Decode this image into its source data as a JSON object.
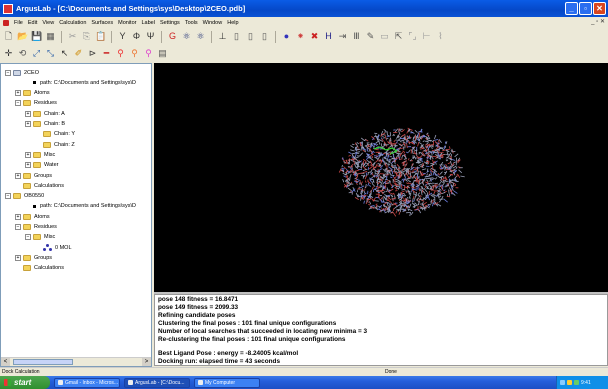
{
  "window": {
    "title": "ArgusLab - [C:\\Documents and Settings\\sys\\Desktop\\2CEO.pdb]",
    "minimize": "_",
    "restore": "▫",
    "close": "✕"
  },
  "menu": {
    "items": [
      "File",
      "Edit",
      "View",
      "Calculation",
      "Surfaces",
      "Monitor",
      "Label",
      "Settings",
      "Tools",
      "Window",
      "Help"
    ],
    "window_controls": "_ ▫ ✕"
  },
  "toolbar1": {
    "icons": [
      "new-file-icon",
      "open-folder-icon",
      "save-icon",
      "print-icon",
      "cut-icon",
      "copy-icon",
      "paste-icon",
      "y-icon",
      "phi-icon",
      "psi-icon",
      "g-icon",
      "ligand-icon",
      "build-icon",
      "perpendicular-icon",
      "box-icon",
      "box2-icon",
      "box3-icon",
      "dot-icon",
      "hydrogen-icon",
      "x-icon",
      "h-icon",
      "hetero-icon",
      "bond-icon",
      "arrow-icon",
      "square-icon",
      "select-icon",
      "bracket-icon",
      "path-icon",
      "link-icon"
    ],
    "glyphs": [
      "🗋",
      "📂",
      "💾",
      "▦",
      "✂",
      "⎘",
      "📋",
      "Y",
      "Φ",
      "Ψ",
      "G",
      "⚛",
      "⚛",
      "⊥",
      "▯",
      "▯",
      "▯",
      "●",
      "⁕",
      "✖",
      "H",
      "⇥",
      "Ⅲ",
      "✎",
      "▭",
      "⇱",
      "⌜⌟",
      "⊢",
      "⌇"
    ]
  },
  "toolbar2": {
    "icons": [
      "rotate-icon",
      "translate-icon",
      "zoom-icon",
      "zoom2-icon",
      "arrow-select-icon",
      "pencil-icon",
      "residue-icon",
      "minus-icon",
      "atom-red-icon",
      "atom-orange-icon",
      "atom-pink-icon",
      "grid-icon"
    ],
    "glyphs": [
      "✛",
      "⟲",
      "⤢",
      "⤡",
      "↖",
      "✐",
      "⊳",
      "━",
      "⚲",
      "⚲",
      "⚲",
      "▤"
    ]
  },
  "tree": {
    "nodes": [
      {
        "label": "2CEO",
        "pm": "−",
        "kind": "root",
        "indent": 0
      },
      {
        "label": "path: C:\\Documents and Settings\\sys\\D",
        "pm": "",
        "kind": "dot",
        "indent": 2
      },
      {
        "label": "Atoms",
        "pm": "+",
        "kind": "folder",
        "indent": 1
      },
      {
        "label": "Residues",
        "pm": "−",
        "kind": "folder",
        "indent": 1
      },
      {
        "label": "Chain: A",
        "pm": "+",
        "kind": "folder",
        "indent": 2
      },
      {
        "label": "Chain: B",
        "pm": "+",
        "kind": "folder",
        "indent": 2
      },
      {
        "label": "Chain: Y",
        "pm": "",
        "kind": "folder",
        "indent": 3
      },
      {
        "label": "Chain: Z",
        "pm": "",
        "kind": "folder",
        "indent": 3
      },
      {
        "label": "Misc",
        "pm": "+",
        "kind": "folder",
        "indent": 2
      },
      {
        "label": "Water",
        "pm": "+",
        "kind": "folder",
        "indent": 2
      },
      {
        "label": "Groups",
        "pm": "+",
        "kind": "folder",
        "indent": 1
      },
      {
        "label": "Calculations",
        "pm": "",
        "kind": "folder",
        "indent": 1
      },
      {
        "label": "OB0550",
        "pm": "−",
        "kind": "folder",
        "indent": 0
      },
      {
        "label": "path: C:\\Documents and Settings\\sys\\D",
        "pm": "",
        "kind": "dot",
        "indent": 2
      },
      {
        "label": "Atoms",
        "pm": "+",
        "kind": "folder",
        "indent": 1
      },
      {
        "label": "Residues",
        "pm": "−",
        "kind": "folder",
        "indent": 1
      },
      {
        "label": "Misc",
        "pm": "−",
        "kind": "folder",
        "indent": 2
      },
      {
        "label": "0 MOL",
        "pm": "",
        "kind": "mol",
        "indent": 3
      },
      {
        "label": "Groups",
        "pm": "+",
        "kind": "folder",
        "indent": 1
      },
      {
        "label": "Calculations",
        "pm": "",
        "kind": "folder",
        "indent": 1
      }
    ],
    "scroll_left": "<",
    "scroll_right": ">"
  },
  "output": {
    "lines": [
      "pose 148 fitness = 16.8471",
      "pose 149 fitness = 2099.33",
      "Refining candidate poses",
      "Clustering the final poses : 101 final unique configurations",
      "Number of local searches that succeeded in locating new minima = 3",
      "Re-clustering the final poses : 101 final unique configurations",
      "",
      "Best Ligand Pose : energy = -8.24005 kcal/mol",
      "Docking run: elapsed time = 43 seconds"
    ]
  },
  "status": {
    "left": "Dock Calculation",
    "right": "Done"
  },
  "taskbar": {
    "start": "start",
    "tasks": [
      "Gmail - Inbox - Micros...",
      "ArgusLab - [C:\\Docu...",
      "My Computer"
    ],
    "clock": "9:41"
  },
  "colors": {
    "title_bar": "#0548c8",
    "viewer_bg": "#000000",
    "protein_gray": "#9aa0b8",
    "protein_red": "#c84646",
    "ligand_green": "#35d635"
  }
}
